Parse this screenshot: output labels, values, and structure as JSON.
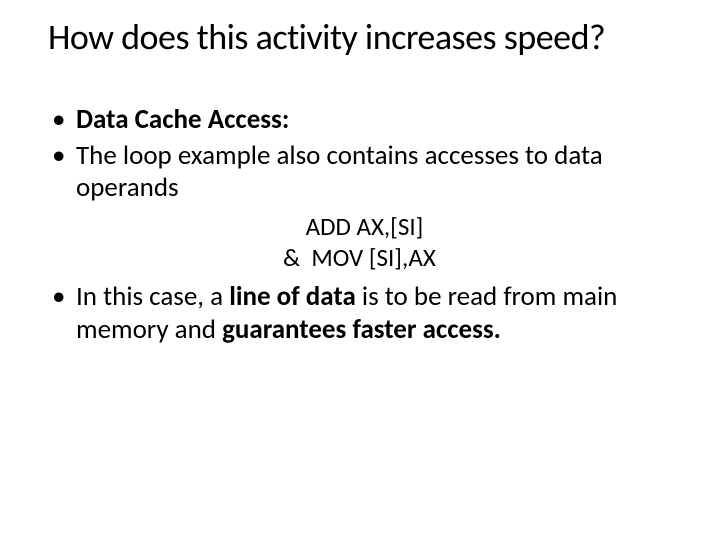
{
  "title": "How does this activity increases speed?",
  "bullets": {
    "b1_bold": "Data Cache Access:",
    "b2": "The loop example also contains accesses to data operands",
    "code_line1": "ADD AX,[SI]",
    "code_amp": "&",
    "code_line2": "MOV [SI],AX",
    "b3_pre": "In this case, a ",
    "b3_bold1": "line of data",
    "b3_mid": " is to be read from main memory and ",
    "b3_bold2": "guarantees faster access."
  }
}
